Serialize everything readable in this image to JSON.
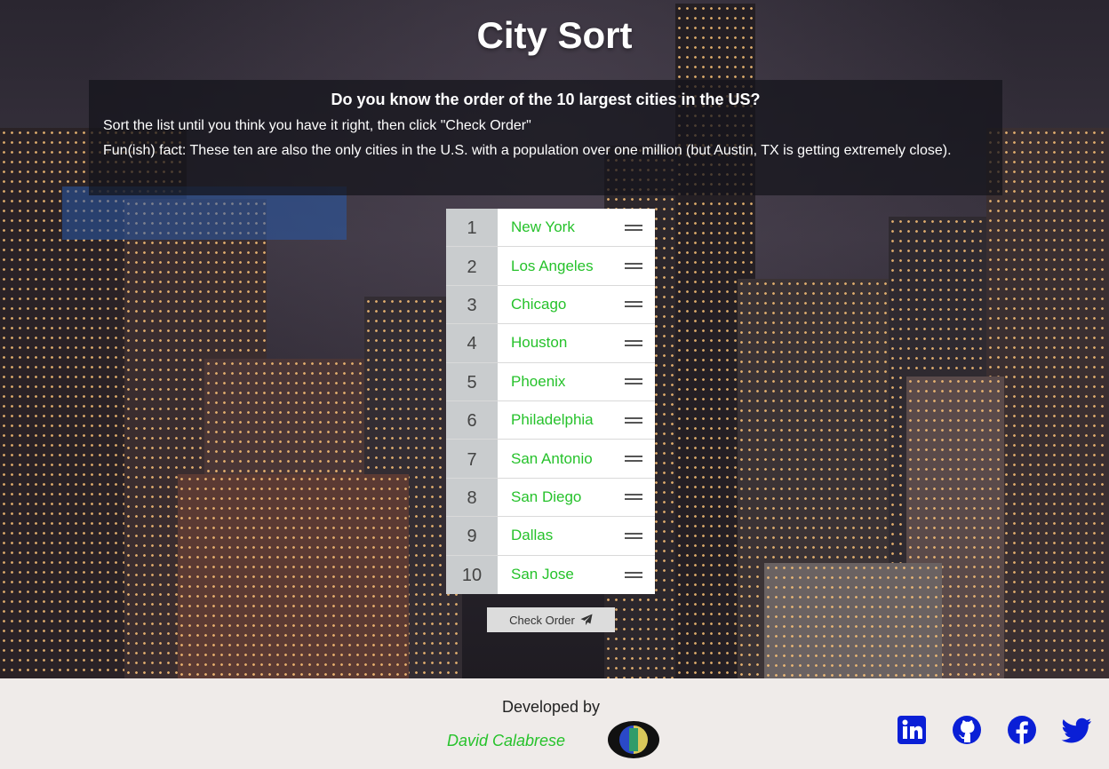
{
  "header": {
    "title": "City Sort"
  },
  "intro": {
    "question": "Do you know the order of the 10 largest cities in the US?",
    "instruction": "Sort the list until you think you have it right, then click \"Check Order\"",
    "fact": "Fun(ish) fact: These ten are also the only cities in the U.S. with a population over one million (but Austin, TX is getting extremely close)."
  },
  "list": {
    "items": [
      {
        "rank": "1",
        "city": "New York"
      },
      {
        "rank": "2",
        "city": "Los Angeles"
      },
      {
        "rank": "3",
        "city": "Chicago"
      },
      {
        "rank": "4",
        "city": "Houston"
      },
      {
        "rank": "5",
        "city": "Phoenix"
      },
      {
        "rank": "6",
        "city": "Philadelphia"
      },
      {
        "rank": "7",
        "city": "San Antonio"
      },
      {
        "rank": "8",
        "city": "San Diego"
      },
      {
        "rank": "9",
        "city": "Dallas"
      },
      {
        "rank": "10",
        "city": "San Jose"
      }
    ]
  },
  "actions": {
    "check_label": "Check Order",
    "check_icon": "paper-plane-icon"
  },
  "footer": {
    "developed_by": "Developed by",
    "developer_name": "David Calabrese",
    "social_icons": [
      "linkedin-icon",
      "github-icon",
      "facebook-icon",
      "twitter-icon"
    ]
  },
  "colors": {
    "accent_green": "#26c22b",
    "social_blue": "#0a1fd6",
    "rank_bg": "#c9ccce",
    "footer_bg": "#efebe9"
  }
}
